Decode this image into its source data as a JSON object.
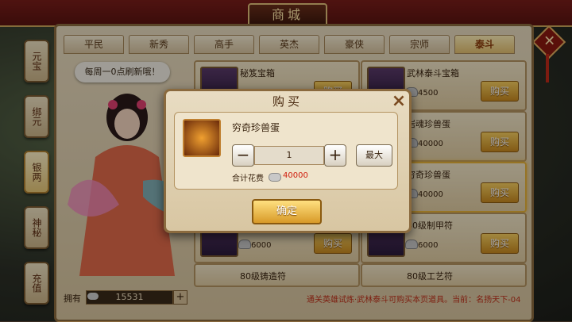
{
  "window": {
    "title": "商城"
  },
  "side_tabs": [
    "元宝",
    "绑元",
    "银两",
    "神秘",
    "充值"
  ],
  "category_tabs": [
    "平民",
    "新秀",
    "高手",
    "英杰",
    "豪侠",
    "宗师",
    "泰斗"
  ],
  "bubble_text": "每周一0点刷新哦！",
  "items": [
    {
      "name": "秘笈宝箱",
      "price": "",
      "buy": "购买"
    },
    {
      "name": "武林泰斗宝箱",
      "price": "4500",
      "buy": "购买"
    },
    {
      "name": "",
      "price": "",
      "buy": ""
    },
    {
      "name": "岩魂珍兽蛋",
      "price": "40000",
      "buy": "购买"
    },
    {
      "name": "",
      "price": "",
      "buy": ""
    },
    {
      "name": "穷奇珍兽蛋",
      "price": "40000",
      "buy": "购买"
    },
    {
      "name": "",
      "price": "6000",
      "buy": "购买"
    },
    {
      "name": "80级制甲符",
      "price": "6000",
      "buy": "购买"
    },
    {
      "name": "80级铸造符",
      "price": "",
      "buy": ""
    },
    {
      "name": "80级工艺符",
      "price": "",
      "buy": ""
    }
  ],
  "owned": {
    "label": "拥有",
    "value": "15531",
    "plus": "+"
  },
  "notice": "通关英雄试炼·武林泰斗可购买本页道具。当前：名扬天下-04",
  "modal": {
    "title": "购买",
    "close": "×",
    "item_name": "穷奇珍兽蛋",
    "minus": "−",
    "plus": "+",
    "quantity": "1",
    "max": "最大",
    "total_label": "合计花费",
    "total_value": "40000",
    "confirm": "确定"
  },
  "close_main": "✕"
}
